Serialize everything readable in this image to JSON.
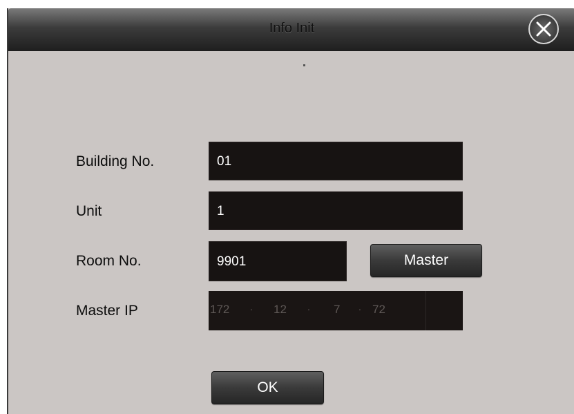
{
  "dialog": {
    "title": "Info Init",
    "close_icon": "close-x-icon"
  },
  "form": {
    "building": {
      "label": "Building No.",
      "value": "01"
    },
    "unit": {
      "label": "Unit",
      "value": "1"
    },
    "room": {
      "label": "Room No.",
      "value": "9901"
    },
    "master_button": "Master",
    "master_ip": {
      "label": "Master IP",
      "octets": [
        "172",
        "12",
        "7",
        "72"
      ],
      "separator": "."
    },
    "ok_button": "OK"
  },
  "colors": {
    "background": "#cbc6c4",
    "titlebar": "#3c3c3c",
    "field": "#171312",
    "field_text": "#ffffff",
    "disabled_text": "#5e5856"
  }
}
